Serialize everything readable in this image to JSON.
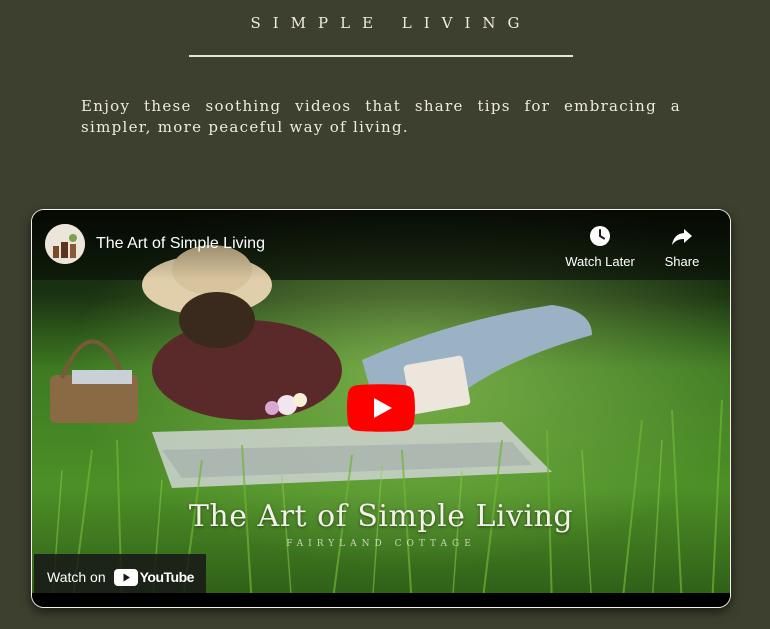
{
  "section": {
    "title": "SIMPLE LIVING",
    "intro": "Enjoy these soothing videos that share tips for embracing a simpler, more peaceful way of living."
  },
  "video": {
    "title": "The Art of Simple Living",
    "overlay_title": "The Art of Simple Living",
    "overlay_subtitle": "FAIRYLAND COTTAGE",
    "watch_later_label": "Watch Later",
    "share_label": "Share",
    "watch_on_label": "Watch on",
    "youtube_wordmark": "YouTube",
    "icons": {
      "avatar": "channel-avatar",
      "watch_later": "clock-icon",
      "share": "share-arrow-icon",
      "play": "play-button-icon",
      "youtube": "youtube-logo-icon"
    },
    "colors": {
      "background": "#3d3f2f",
      "youtube_red": "#ff0000",
      "text": "#eeeae0"
    }
  }
}
